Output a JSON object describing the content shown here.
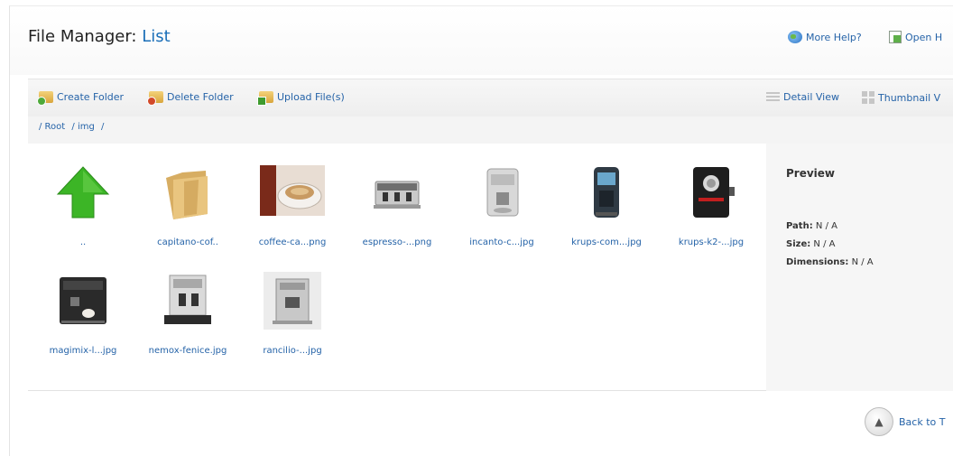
{
  "header": {
    "title_prefix": "File Manager:",
    "title_sub": "List",
    "more_help": "More Help?",
    "open_link": "Open H"
  },
  "toolbar": {
    "create_folder": "Create Folder",
    "delete_folder": "Delete Folder",
    "upload_files": "Upload File(s)",
    "detail_view": "Detail View",
    "thumbnail_view": "Thumbnail V"
  },
  "breadcrumb": [
    "/ Root",
    "/ img",
    "/"
  ],
  "files": [
    {
      "name": "..",
      "icon": "up-arrow-icon"
    },
    {
      "name": "capitano-cof..",
      "icon": "folder-icon"
    },
    {
      "name": "coffee-ca...png",
      "icon": "coffee-cup-icon"
    },
    {
      "name": "espresso-...png",
      "icon": "espresso-machine-icon"
    },
    {
      "name": "incanto-c...jpg",
      "icon": "coffee-machine-icon"
    },
    {
      "name": "krups-com...jpg",
      "icon": "coffee-machine-icon"
    },
    {
      "name": "krups-k2-...jpg",
      "icon": "coffee-machine-icon"
    },
    {
      "name": "magimix-l...jpg",
      "icon": "coffee-machine-icon"
    },
    {
      "name": "nemox-fenice.jpg",
      "icon": "coffee-machine-icon"
    },
    {
      "name": "rancilio-...jpg",
      "icon": "coffee-machine-icon"
    }
  ],
  "preview": {
    "title": "Preview",
    "path_label": "Path:",
    "path_value": "N / A",
    "size_label": "Size:",
    "size_value": "N / A",
    "dimensions_label": "Dimensions:",
    "dimensions_value": "N / A"
  },
  "back_to_top": "Back to T"
}
